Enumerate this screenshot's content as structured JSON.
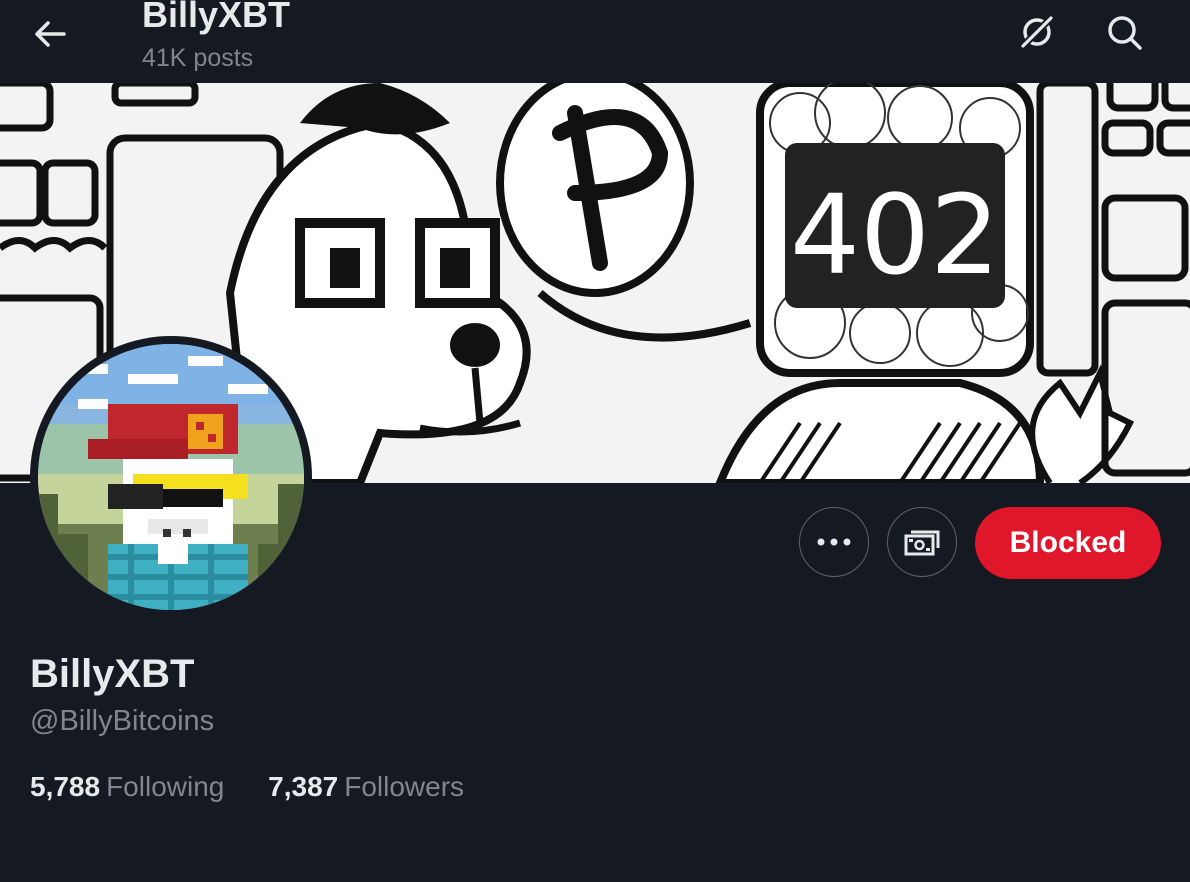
{
  "header": {
    "title": "BillyXBT",
    "post_count": "41K posts"
  },
  "banner": {
    "badge_text": "402"
  },
  "profile": {
    "display_name": "BillyXBT",
    "handle": "@BillyBitcoins",
    "following_count": "5,788",
    "following_label": "Following",
    "followers_count": "7,387",
    "followers_label": "Followers"
  },
  "actions": {
    "blocked_label": "Blocked"
  },
  "icons": {
    "back": "arrow-left-icon",
    "grok": "grok-icon",
    "search": "search-icon",
    "more": "more-horizontal-icon",
    "tip": "money-icon"
  },
  "colors": {
    "background": "#141922",
    "blocked": "#e0162b",
    "muted_text": "#7e8790"
  }
}
